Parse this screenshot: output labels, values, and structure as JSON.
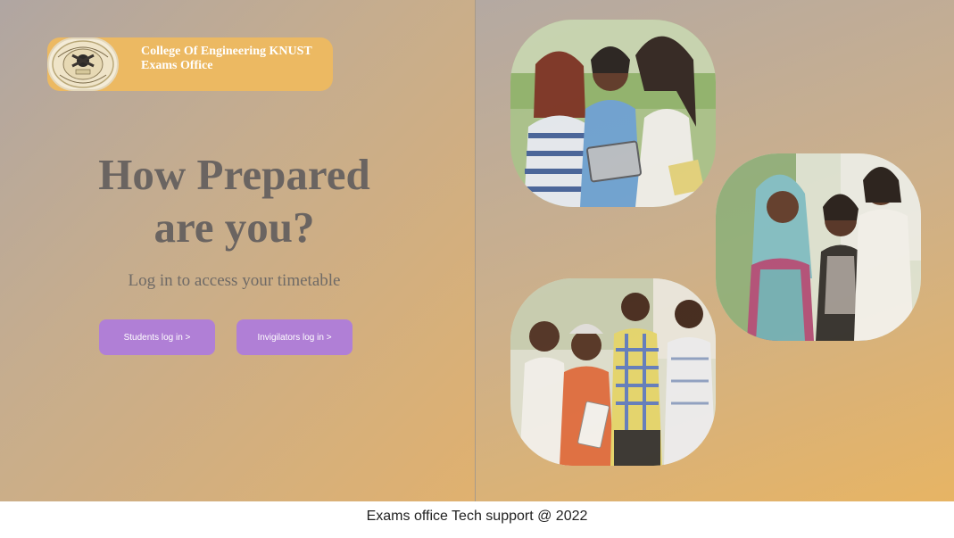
{
  "header": {
    "org_line1": "College Of Engineering KNUST",
    "org_line2": "Exams Office",
    "logo_icon": "college-crest-icon"
  },
  "hero": {
    "title_line1": "How Prepared",
    "title_line2": "are you?",
    "subtitle": "Log in to access your timetable"
  },
  "buttons": {
    "students_label": "Students log in >",
    "invigilators_label": "Invigilators log in >",
    "color": "#b07fd6"
  },
  "gallery": {
    "photos": [
      {
        "subject": "three students looking at a tablet"
      },
      {
        "subject": "three women chatting outdoors"
      },
      {
        "subject": "group of young men talking"
      }
    ]
  },
  "footer": {
    "text": "Exams office Tech support @ 2022"
  },
  "colors": {
    "brand_bg": "#ecb962",
    "heading": "#6a6461"
  }
}
